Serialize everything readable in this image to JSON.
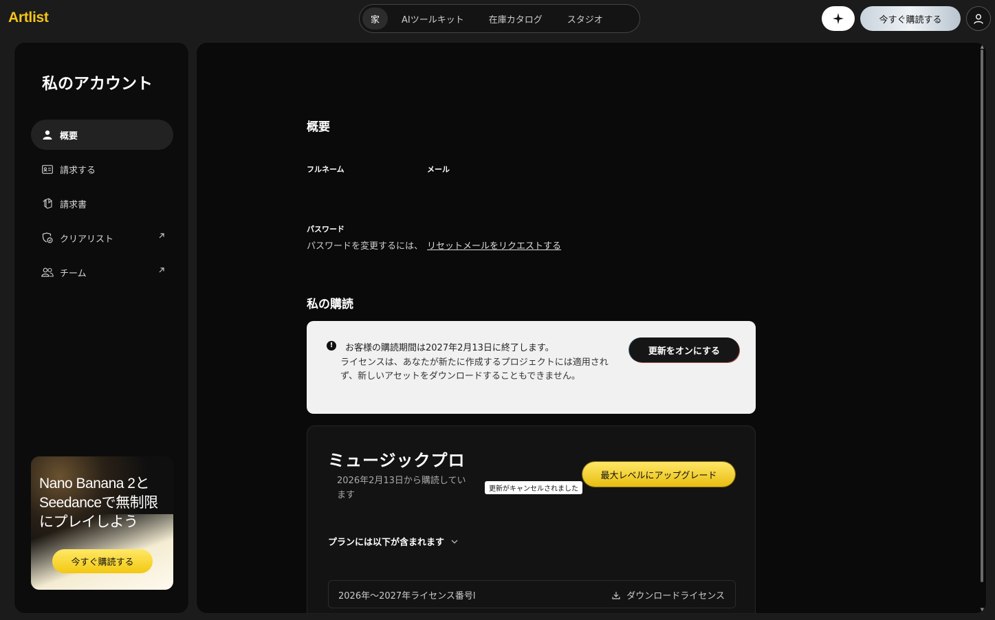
{
  "brand": {
    "logo": "Artlist",
    "accent": "#f5c518"
  },
  "topnav": {
    "tabs": [
      {
        "label": "家",
        "active": true
      },
      {
        "label": "AIツールキット",
        "active": false
      },
      {
        "label": "在庫カタログ",
        "active": false
      },
      {
        "label": "スタジオ",
        "active": false
      }
    ],
    "ai_icon": "sparkle-icon",
    "subscribe_label": "今すぐ購読する",
    "user_icon": "user-icon"
  },
  "sidebar": {
    "title": "私のアカウント",
    "items": [
      {
        "label": "概要",
        "icon": "user-icon",
        "active": true,
        "external": false
      },
      {
        "label": "請求する",
        "icon": "id-card-icon",
        "active": false,
        "external": false
      },
      {
        "label": "請求書",
        "icon": "invoice-icon",
        "active": false,
        "external": false
      },
      {
        "label": "クリアリスト",
        "icon": "clear-list-icon",
        "active": false,
        "external": true
      },
      {
        "label": "チーム",
        "icon": "team-icon",
        "active": false,
        "external": true
      }
    ],
    "promo": {
      "text": "Nano Banana 2とSeedanceで無制限にプレイしよう",
      "button": "今すぐ購読する"
    }
  },
  "main": {
    "overview_heading": "概要",
    "fullname_label": "フルネーム",
    "email_label": "メール",
    "password_label": "パスワード",
    "password_text": "パスワードを変更するには、",
    "password_link": "リセットメールをリクエストする",
    "subscription_heading": "私の購読",
    "notice": {
      "title": "お客様の購読期間は2027年2月13日に終了します。",
      "body": "ライセンスは、あなたが新たに作成するプロジェクトには適用されず、新しいアセットをダウンロードすることもできません。",
      "button": "更新をオンにする"
    },
    "plan": {
      "name": "ミュージックプロ",
      "since": "2026年2月13日から購読しています",
      "badge": "更新がキャンセルされました",
      "upgrade": "最大レベルにアップグレード",
      "includes": "プランには以下が含まれます",
      "license_name": "2026年～2027年ライセンス番号l",
      "download": "ダウンロードライセンス"
    }
  }
}
